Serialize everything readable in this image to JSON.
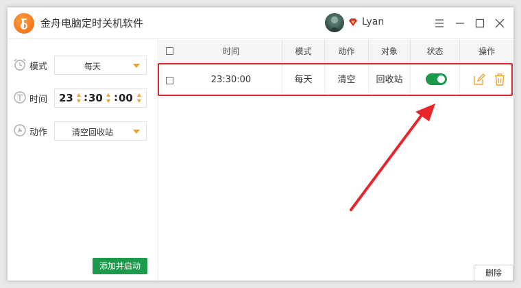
{
  "app": {
    "title": "金舟电脑定时关机软件"
  },
  "user": {
    "name": "Lyan"
  },
  "window_controls": [
    {
      "name": "menu-icon"
    },
    {
      "name": "minimize-icon"
    },
    {
      "name": "maximize-icon"
    },
    {
      "name": "close-icon"
    }
  ],
  "form": {
    "mode": {
      "label": "模式",
      "value": "每天"
    },
    "time": {
      "label": "时间",
      "hour": "23",
      "minute": "30",
      "second": "00",
      "sep": ":"
    },
    "action": {
      "label": "动作",
      "value": "清空回收站"
    },
    "submit_label": "添加并启动"
  },
  "table": {
    "headers": [
      "时间",
      "模式",
      "动作",
      "对象",
      "状态",
      "操作"
    ],
    "rows": [
      {
        "time": "23:30:00",
        "mode": "每天",
        "action": "清空",
        "target": "回收站",
        "enabled": true
      }
    ],
    "delete_label": "删除"
  },
  "colors": {
    "accent": "#f0a030",
    "green": "#1b9a4b",
    "highlight": "#e0262a"
  }
}
